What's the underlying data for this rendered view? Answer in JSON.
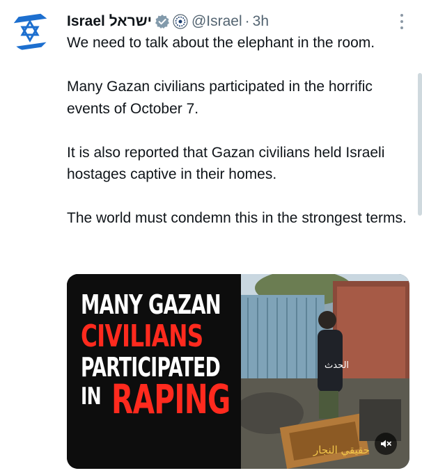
{
  "author": {
    "display_name": "Israel ישראל",
    "handle": "@Israel",
    "separator": "·",
    "time": "3h",
    "verified_badge_icon": "verified-gray-badge-icon",
    "affiliate_icon": "government-seal-icon",
    "avatar_icon": "star-of-david-icon"
  },
  "tweet": {
    "paragraphs": [
      "We need to talk about the elephant in the room.",
      "Many Gazan civilians participated in the horrific events of October 7.",
      "It is also reported that Gazan civilians held Israeli hostages captive in their homes.",
      "The world must condemn this in the strongest terms."
    ]
  },
  "media": {
    "headline_line1": "MANY GAZAN",
    "headline_line2": "CIVILIANS",
    "headline_line3": "PARTICIPATED",
    "headline_line4a": "IN",
    "headline_line4b": "RAPING",
    "channel_watermark": "الحدث",
    "caption_arabic": "حقيقي النجار",
    "mute_icon": "speaker-muted-icon"
  },
  "colors": {
    "accent_blue": "#1d9bf0",
    "headline_red": "#ff2a1e",
    "text_primary": "#0f1419",
    "text_secondary": "#536471"
  }
}
